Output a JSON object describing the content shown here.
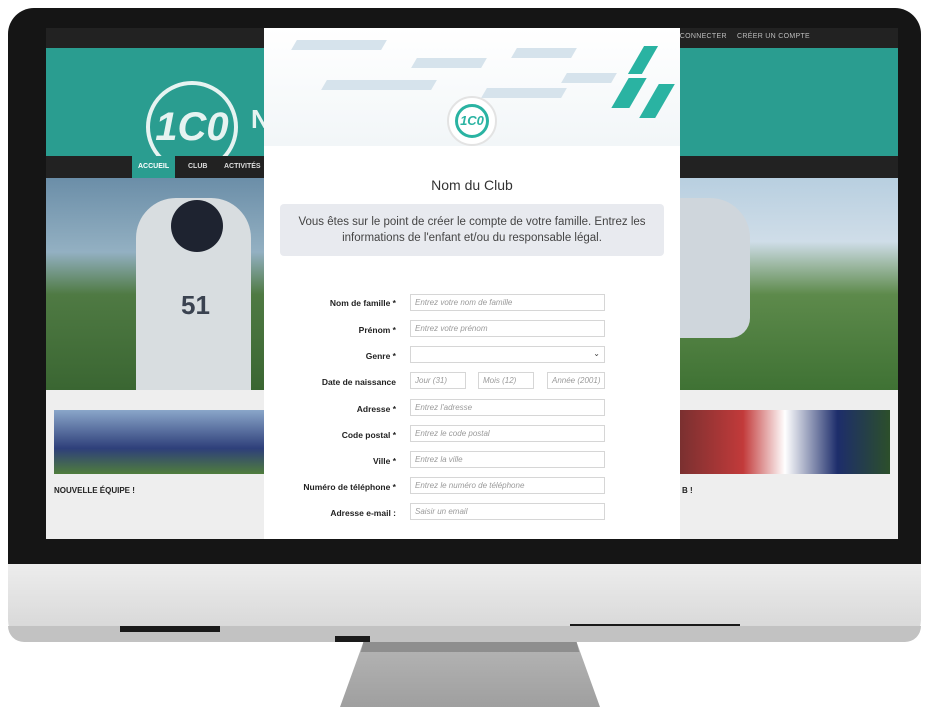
{
  "topbar": {
    "links": [
      "SE CONNECTER",
      "CRÉER UN COMPTE"
    ]
  },
  "header": {
    "logo_text": "1C0",
    "site_initial": "N"
  },
  "nav": {
    "items": [
      "ACCUEIL",
      "CLUB",
      "ACTIVITÉS"
    ]
  },
  "cards": [
    {
      "title": "NOUVELLE ÉQUIPE !"
    },
    {
      "title": "B !"
    }
  ],
  "hero": {
    "jersey_number": "51"
  },
  "modal": {
    "logo_text": "1C0",
    "title": "Nom du Club",
    "info_line1": "Vous êtes sur le point de créer le compte de votre famille. Entrez les",
    "info_line2": "informations de l'enfant et/ou du responsable légal.",
    "fields": [
      {
        "label": "Nom de famille *",
        "placeholder": "Entrez votre nom de famille"
      },
      {
        "label": "Prénom *",
        "placeholder": "Entrez votre prénom"
      },
      {
        "label": "Genre *",
        "placeholder": ""
      },
      {
        "label": "Date de naissance",
        "placeholder": ""
      },
      {
        "label": "Adresse *",
        "placeholder": "Entrez l'adresse"
      },
      {
        "label": "Code postal *",
        "placeholder": "Entrez le code postal"
      },
      {
        "label": "Ville *",
        "placeholder": "Entrez la ville"
      },
      {
        "label": "Numéro de téléphone *",
        "placeholder": "Entrez le numéro de téléphone"
      },
      {
        "label": "Adresse e-mail :",
        "placeholder": "Saisir un email"
      }
    ],
    "dob": {
      "day": "Jour (31)",
      "month": "Mois (12)",
      "year": "Année (2001)"
    },
    "genre_selected": ""
  },
  "colors": {
    "brand": "#2a9d90",
    "accent": "#2ab3a2",
    "dark": "#222222"
  }
}
